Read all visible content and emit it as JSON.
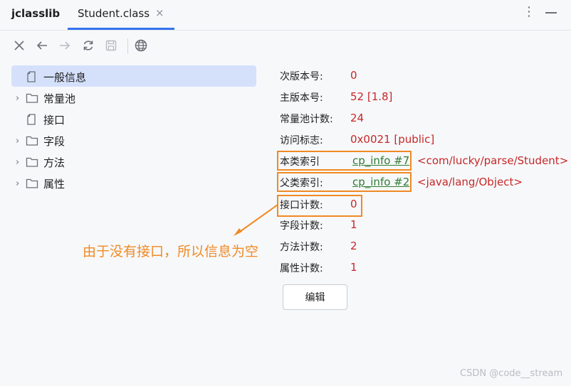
{
  "tabs": {
    "app": "jclasslib",
    "file": "Student.class",
    "close": "×",
    "more": "⋮"
  },
  "tree": [
    {
      "label": "一般信息",
      "type": "file",
      "expandable": false,
      "selected": true
    },
    {
      "label": "常量池",
      "type": "folder",
      "expandable": true,
      "selected": false
    },
    {
      "label": "接口",
      "type": "file",
      "expandable": false,
      "selected": false
    },
    {
      "label": "字段",
      "type": "folder",
      "expandable": true,
      "selected": false
    },
    {
      "label": "方法",
      "type": "folder",
      "expandable": true,
      "selected": false
    },
    {
      "label": "属性",
      "type": "folder",
      "expandable": true,
      "selected": false
    }
  ],
  "details": {
    "minor_version": {
      "label": "次版本号:",
      "value": "0"
    },
    "major_version": {
      "label": "主版本号:",
      "value": "52 [1.8]"
    },
    "cp_count": {
      "label": "常量池计数:",
      "value": "24"
    },
    "access_flags": {
      "label": "访问标志:",
      "value": "0x0021 [public]"
    },
    "this_class": {
      "label": "本类索引",
      "value": "cp_info #7",
      "extra": "<com/lucky/parse/Student>"
    },
    "super_class": {
      "label": "父类索引:",
      "value": "cp_info #2",
      "extra": "<java/lang/Object>"
    },
    "interfaces_count": {
      "label": "接口计数:",
      "value": "0"
    },
    "fields_count": {
      "label": "字段计数:",
      "value": "1"
    },
    "methods_count": {
      "label": "方法计数:",
      "value": "2"
    },
    "attributes_count": {
      "label": "属性计数:",
      "value": "1"
    }
  },
  "edit_label": "编辑",
  "annotation": "由于没有接口，所以信息为空",
  "watermark": "CSDN @code__stream",
  "colors": {
    "accent": "#3574f0",
    "value_red": "#c62828",
    "link_green": "#2e7d32",
    "annotation_orange": "#f08a24"
  }
}
